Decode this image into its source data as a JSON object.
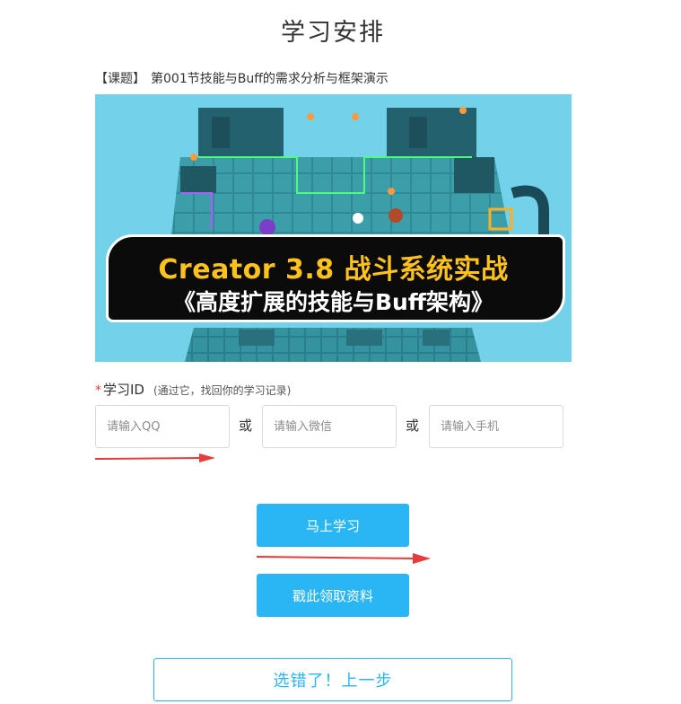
{
  "page": {
    "title": "学习安排"
  },
  "topic": {
    "tag": "【课题】",
    "text": "第001节技能与Buff的需求分析与框架演示"
  },
  "banner": {
    "line1": "Creator 3.8 战斗系统实战",
    "line2": "《高度扩展的技能与Buff架构》",
    "accent_color": "#ffc21a"
  },
  "study_id": {
    "required_mark": "*",
    "label": "学习ID",
    "hint": "(通过它，找回你的学习记录)",
    "inputs": [
      {
        "placeholder": "请输入QQ",
        "value": ""
      },
      {
        "placeholder": "请输入微信",
        "value": ""
      },
      {
        "placeholder": "请输入手机",
        "value": ""
      }
    ],
    "separator": "或"
  },
  "actions": {
    "start_label": "马上学习",
    "materials_label": "戳此领取资料",
    "back_label": "选错了！上一步"
  },
  "colors": {
    "primary": "#2ab6f5",
    "annotation_arrow": "#e63c3c",
    "required": "#e63c3c"
  }
}
